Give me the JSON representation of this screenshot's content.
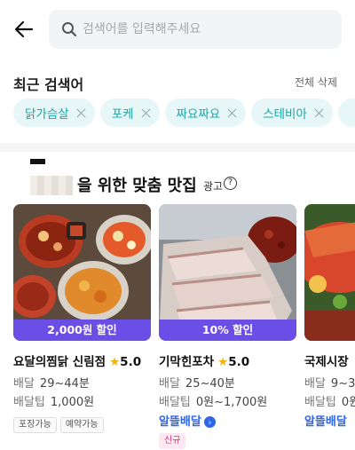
{
  "header": {
    "back_icon": "arrow-left-icon",
    "search_placeholder": "검색어를 입력해주세요",
    "search_icon": "search-icon"
  },
  "recent": {
    "title": "최근 검색어",
    "clear_all": "전체 삭제",
    "chips": [
      "닭가슴살",
      "포케",
      "짜요짜요",
      "스테비아"
    ]
  },
  "section": {
    "title": "을 위한 맞춤 맛집",
    "ad_label": "광고",
    "info_icon": "?"
  },
  "cards": [
    {
      "discount": "2,000원 할인",
      "name": "요달의찜닭 신림점",
      "rating_star": "★",
      "rating": "5.0",
      "delivery_label": "배달",
      "delivery_time": "29~44분",
      "tip_label": "배달팁",
      "tip": "1,000원",
      "tags": [
        "포장가능",
        "예약가능"
      ]
    },
    {
      "discount": "10% 할인",
      "name": "기막힌포차",
      "rating_star": "★",
      "rating": "5.0",
      "delivery_label": "배달",
      "delivery_time": "25~40분",
      "tip_label": "배달팁",
      "tip": "0원~1,700원",
      "albal": "알뜰배달",
      "new_tag": "신규"
    },
    {
      "name": "국제시장",
      "delivery_label": "배달",
      "delivery_time": "9~3",
      "tip_label": "배달팁",
      "tip": "0원",
      "albal": "알뜰배달"
    }
  ]
}
